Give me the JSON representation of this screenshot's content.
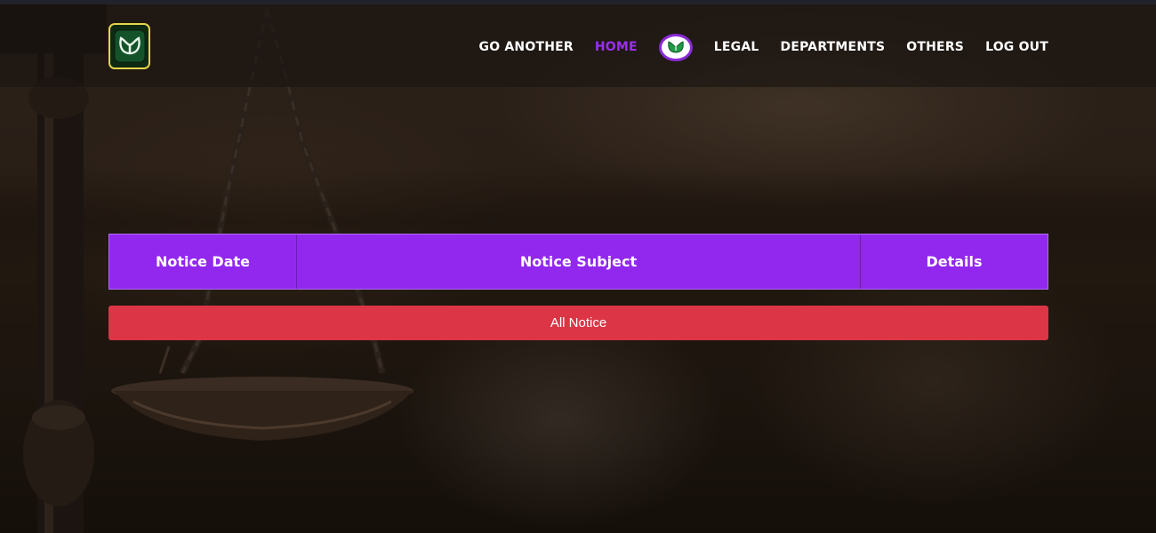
{
  "header": {
    "logo_icon": "lotus-leaf-logo-icon",
    "logo_border_color": "#e8d44a"
  },
  "nav": {
    "items": [
      {
        "label": "GO ANOTHER",
        "active": false
      },
      {
        "label": "HOME",
        "active": true
      },
      {
        "label": "LEGAL",
        "active": false
      },
      {
        "label": "DEPARTMENTS",
        "active": false
      },
      {
        "label": "OTHERS",
        "active": false
      },
      {
        "label": "LOG OUT",
        "active": false
      }
    ],
    "badge_icon": "lotus-leaf-badge-icon",
    "active_color": "#9b2ef0"
  },
  "table": {
    "headers": {
      "date": "Notice Date",
      "subject": "Notice Subject",
      "details": "Details"
    },
    "header_color": "#9228ee",
    "rows": []
  },
  "all_notice": {
    "label": "All Notice",
    "color": "#dc3545"
  }
}
